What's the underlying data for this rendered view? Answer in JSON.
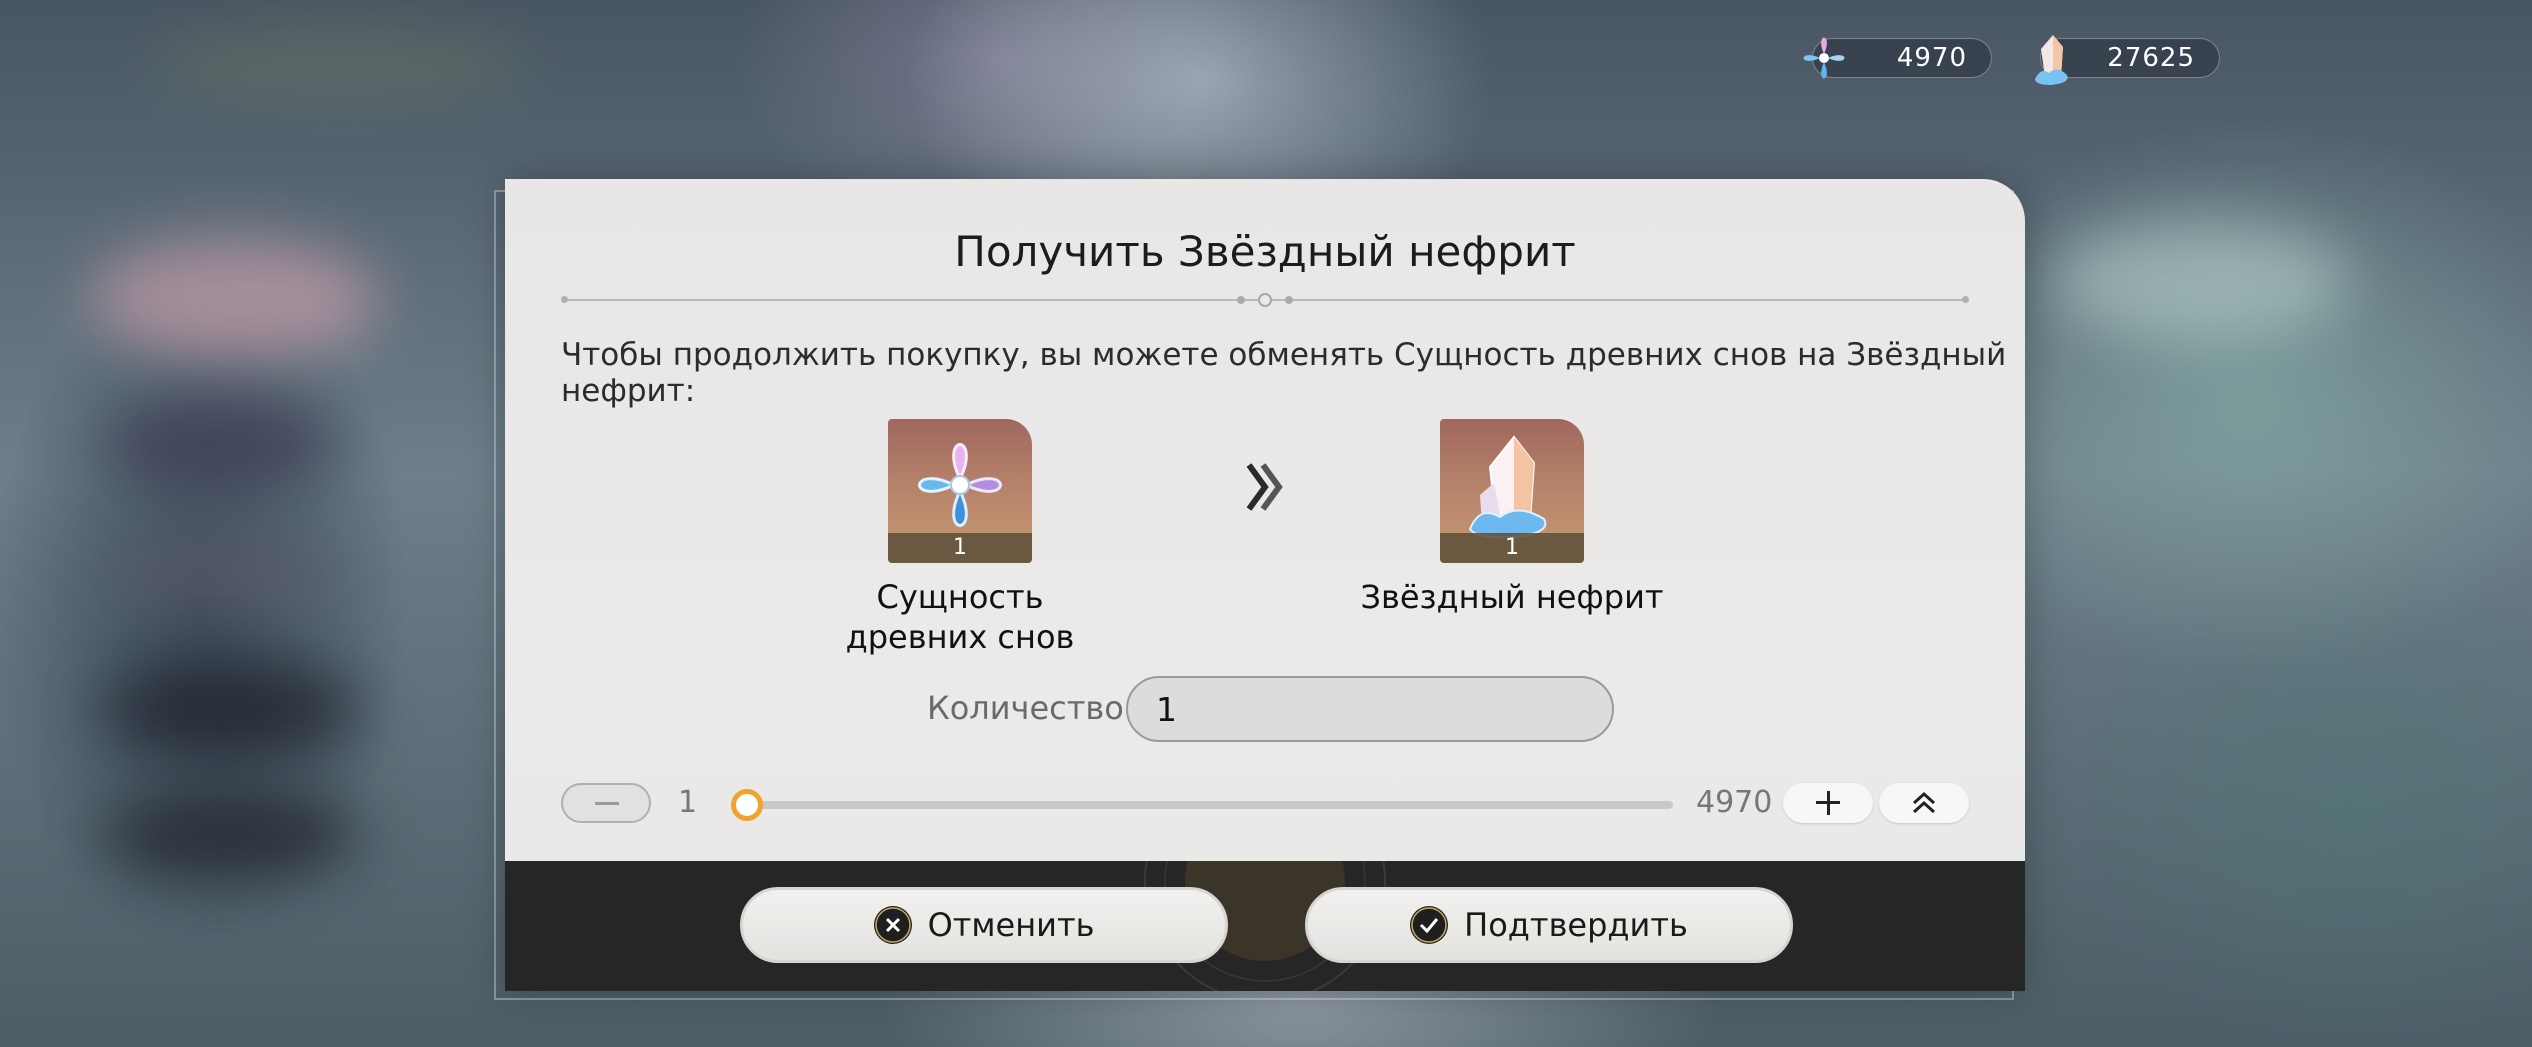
{
  "currencies": {
    "essence": {
      "value": "4970",
      "icon": "dream-essence-icon"
    },
    "jade": {
      "value": "27625",
      "icon": "stellar-jade-icon"
    }
  },
  "dialog": {
    "title": "Получить Звёздный нефрит",
    "description": "Чтобы продолжить покупку, вы можете обменять Сущность древних снов на Звёздный нефрит:",
    "from_item": {
      "name": "Сущность древних снов",
      "quantity": "1",
      "icon": "dream-essence-icon"
    },
    "to_item": {
      "name": "Звёздный нефрит",
      "quantity": "1",
      "icon": "stellar-jade-icon"
    },
    "quantity_label": "Количество:",
    "quantity_value": "1",
    "slider": {
      "min_label": "1",
      "max_label": "4970",
      "value": 1
    },
    "cancel_label": "Отменить",
    "confirm_label": "Подтвердить"
  },
  "colors": {
    "slider_knob": "#f0a330",
    "footer": "#262626",
    "panel": "#ebeae9"
  }
}
